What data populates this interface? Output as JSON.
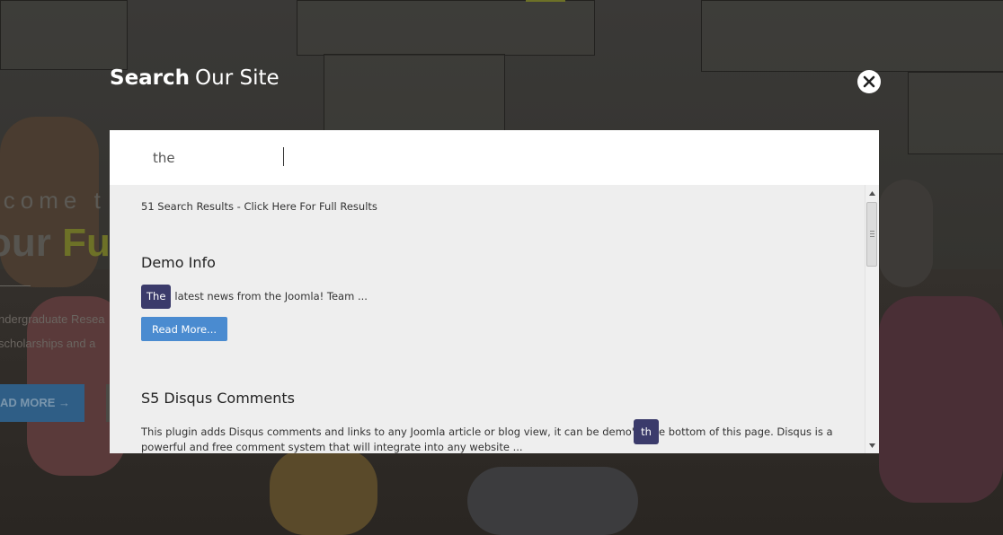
{
  "background": {
    "welcome_text": "lcome t",
    "headline_prefix": "our ",
    "headline_highlight": "Fu",
    "line1": "ndergraduate Resea",
    "line2": "scholarships and a",
    "button_label": "AD MORE  →"
  },
  "overlay": {
    "title_bold": "Search",
    "title_light": "Our Site",
    "close_icon": "close-icon"
  },
  "search": {
    "value": "the",
    "placeholder": ""
  },
  "results": {
    "summary": "51 Search Results - Click Here For Full Results",
    "items": [
      {
        "title": "Demo Info",
        "highlight": "The",
        "snippet_rest": "latest news from the Joomla! Team  ...",
        "read_more": "Read More..."
      },
      {
        "title": "S5 Disqus Comments",
        "snippet_line1_before": "This plugin adds Disqus comments and links to any Joomla article or blog view, it can be demo'd at",
        "highlight": "th",
        "snippet_line1_after": "e bottom of this page. Disqus is a",
        "snippet_line2": "powerful and free comment system that will integrate into any website ..."
      }
    ]
  },
  "colors": {
    "highlight_chip": "#3b3b6b",
    "read_more_button": "#4a8bd0",
    "results_bg": "#eeeeee",
    "accent_green": "#6d7127"
  }
}
